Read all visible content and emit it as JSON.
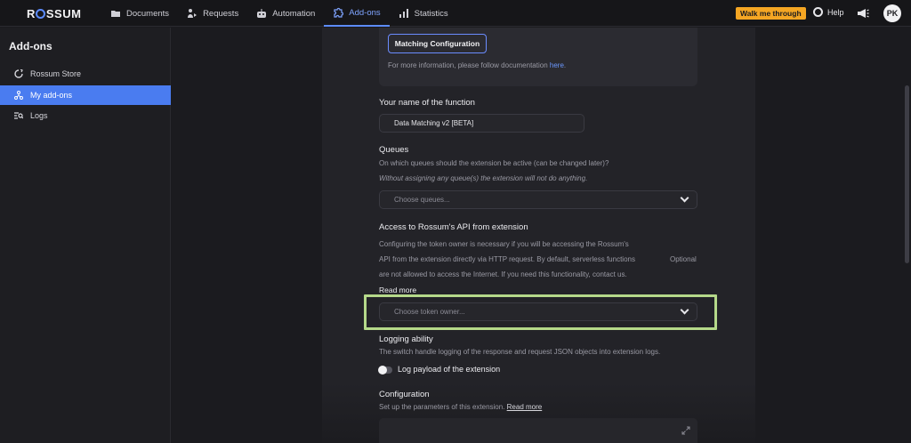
{
  "app": {
    "logo": "ROSSUM",
    "nav": [
      {
        "label": "Documents",
        "icon": "folder-icon"
      },
      {
        "label": "Requests",
        "icon": "requests-icon"
      },
      {
        "label": "Automation",
        "icon": "robot-icon"
      },
      {
        "label": "Add-ons",
        "icon": "puzzle-icon",
        "active": true
      },
      {
        "label": "Statistics",
        "icon": "bar-chart-icon"
      }
    ],
    "walk_me": "Walk me through",
    "help": "Help",
    "avatar": "PK"
  },
  "sidebar": {
    "title": "Add-ons",
    "items": [
      {
        "label": "Rossum Store",
        "icon": "store-icon"
      },
      {
        "label": "My add-ons",
        "icon": "network-icon",
        "active": true
      },
      {
        "label": "Logs",
        "icon": "logs-icon"
      }
    ]
  },
  "main": {
    "matching_button": "Matching Configuration",
    "info_text": "For more information, please follow documentation ",
    "info_link": "here",
    "info_end": ".",
    "name_label": "Your name of the function",
    "name_value": "Data Matching v2 [BETA]",
    "queues_label": "Queues",
    "queues_desc": "On which queues should the extension be active (can be changed later)?",
    "queues_warning": "Without assigning any queue(s) the extension will not do anything.",
    "queues_placeholder": "Choose queues...",
    "api_label": "Access to Rossum's API from extension",
    "api_desc_1": "Configuring the token owner is necessary if you will be accessing the Rossum's",
    "api_desc_2": "API from the extension directly via HTTP request. By default, serverless functions",
    "api_desc_3": "are not allowed to access the Internet. If you need this functionality, contact us.",
    "optional": "Optional",
    "read_more": "Read more",
    "token_placeholder": "Choose token owner...",
    "logging_label": "Logging ability",
    "logging_desc": "The switch handle logging of the response and request JSON objects into extension logs.",
    "log_toggle_label": "Log payload of the extension",
    "config_label": "Configuration",
    "config_desc": "Set up the parameters of this extension. ",
    "config_read_more": "Read more"
  },
  "colors": {
    "accent": "#4a7cf0",
    "walk_me": "#f5a623",
    "highlight": "#b5d98a"
  }
}
